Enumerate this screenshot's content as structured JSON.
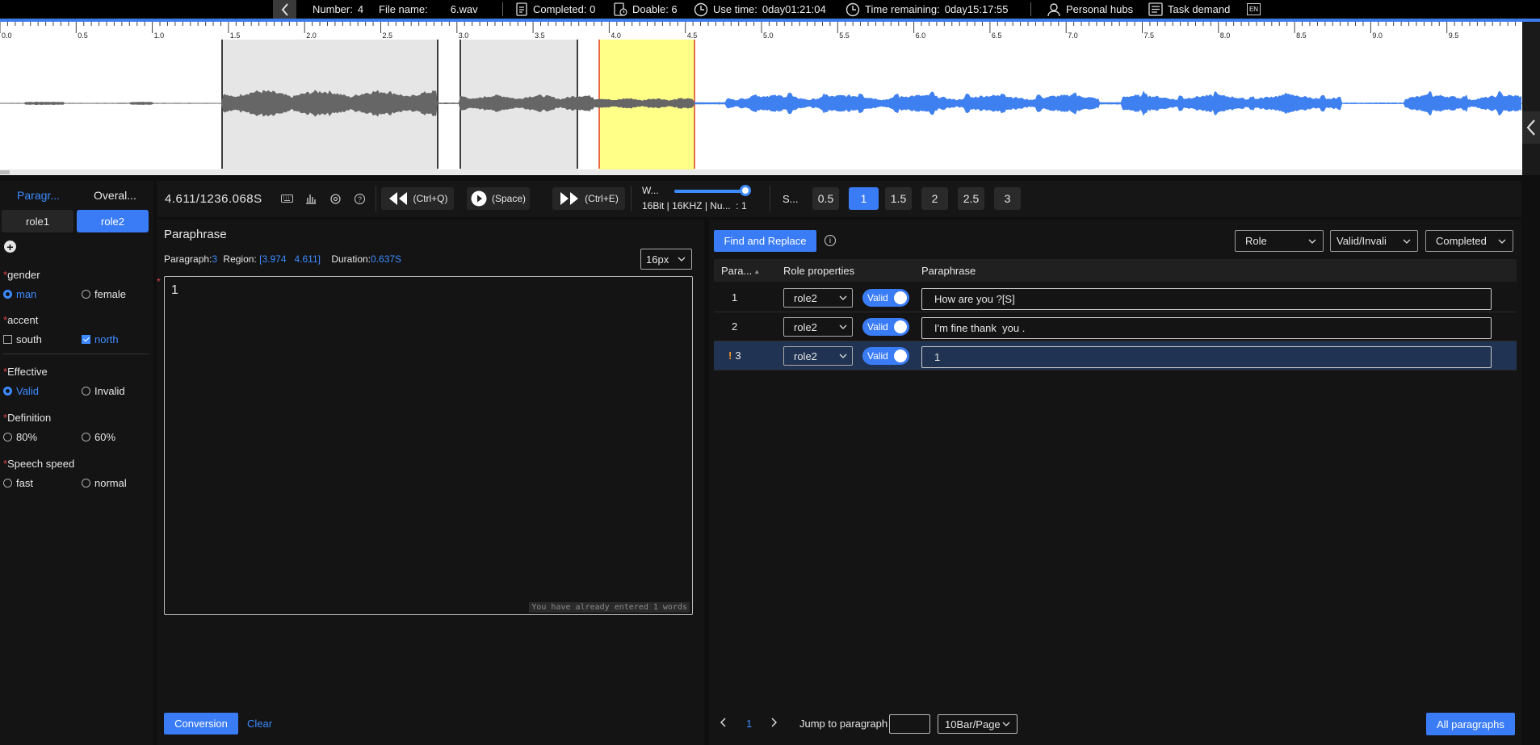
{
  "topbar": {
    "number_label": "Number:",
    "number_value": "4",
    "file_label": "File name:",
    "file_value": "6.wav",
    "completed": "Completed: 0",
    "doable": "Doable: 6",
    "use_time_label": "Use time:",
    "use_time_value": "0day01:21:04",
    "remaining_label": "Time remaining:",
    "remaining_value": "0day15:17:55",
    "personal_hubs": "Personal hubs",
    "task_demand": "Task demand",
    "lang": "EN"
  },
  "waveform": {
    "ticks": [
      "0.0",
      "0.5",
      "1.0",
      "1.5",
      "2.0",
      "2.5",
      "3.0",
      "3.5",
      "4.0",
      "4.5",
      "5.0",
      "5.5",
      "6.0",
      "6.5",
      "7.0",
      "7.5",
      "8.0",
      "8.5",
      "9.0",
      "9.5"
    ],
    "colors": {
      "wave_done": "#666666",
      "wave_pending": "#3f80f0",
      "region_fill": "#e6e6e6",
      "active_fill": "#ffff88",
      "active_border": "#e84a2a"
    }
  },
  "left_panel": {
    "tabs": [
      "Paragr...",
      "Overal..."
    ],
    "roles": [
      "role1",
      "role2"
    ],
    "fields": [
      {
        "label": "gender",
        "options": [
          "man",
          "female"
        ]
      },
      {
        "label": "accent",
        "options": [
          "south",
          "north"
        ]
      },
      {
        "label": "Effective",
        "options": [
          "Valid",
          "Invalid"
        ]
      },
      {
        "label": "Definition",
        "options": [
          "80%",
          "60%"
        ]
      },
      {
        "label": "Speech speed",
        "options": [
          "fast",
          "normal"
        ]
      }
    ]
  },
  "controls": {
    "time": "4.611/1236.068S",
    "rewind_label": "(Ctrl+Q)",
    "play_label": "(Space)",
    "forward_label": "(Ctrl+E)",
    "wave_label": "W...",
    "audio_info": "16Bit | 16KHZ | Nu...  : 1",
    "speed_label": "S...",
    "speeds": [
      "0.5",
      "1",
      "1.5",
      "2",
      "2.5",
      "3"
    ],
    "active_speed": "1"
  },
  "editor": {
    "title": "Paraphrase",
    "paragraph_label": "Paragraph:",
    "paragraph_value": "3",
    "region_label": "Region:",
    "region_value": "[3.974   4.611]",
    "duration_label": "Duration:",
    "duration_value": "0.637S",
    "font_size": "16px",
    "text": "1",
    "word_count": "You have already entered 1 words",
    "conversion": "Conversion",
    "clear": "Clear"
  },
  "table": {
    "find_replace": "Find and Replace",
    "filters": [
      "Role",
      "Valid/Invali",
      "Completed"
    ],
    "headers": [
      "Para...",
      "Role properties",
      "Paraphrase"
    ],
    "rows": [
      {
        "num": "1",
        "role": "role2",
        "valid": "Valid",
        "text": "How are you ?[S]",
        "warn": ""
      },
      {
        "num": "2",
        "role": "role2",
        "valid": "Valid",
        "text": "I'm fine thank  you .",
        "warn": ""
      },
      {
        "num": "3",
        "role": "role2",
        "valid": "Valid",
        "text": "1",
        "warn": "!"
      }
    ],
    "page": "1",
    "jump_label": "Jump to paragraph",
    "per_page": "10Bar/Page",
    "all_paragraphs": "All paragraphs"
  }
}
